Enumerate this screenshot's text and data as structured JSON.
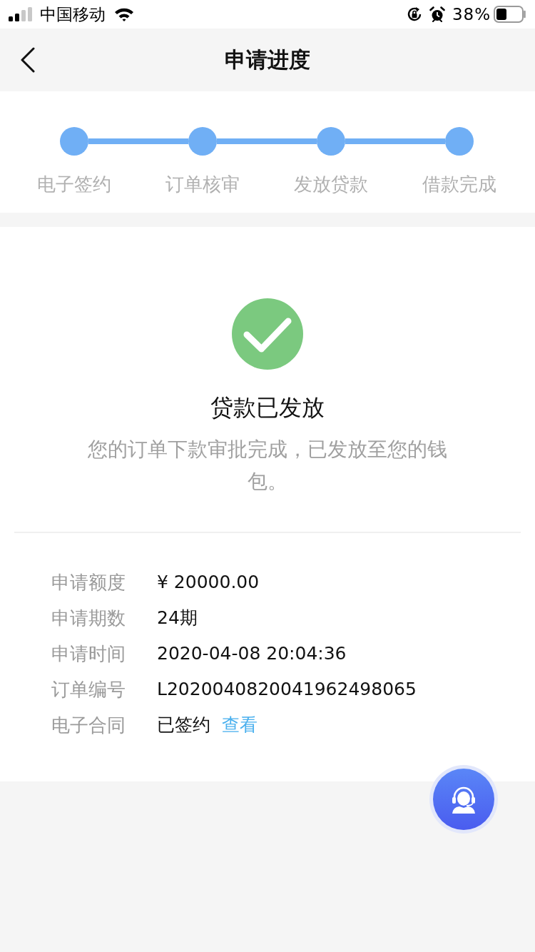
{
  "status_bar": {
    "carrier": "中国移动",
    "battery": "38%"
  },
  "nav": {
    "title": "申请进度"
  },
  "steps": [
    {
      "label": "电子签约",
      "done": true
    },
    {
      "label": "订单核审",
      "done": true
    },
    {
      "label": "发放贷款",
      "done": true
    },
    {
      "label": "借款完成",
      "done": true
    }
  ],
  "result": {
    "title": "贷款已发放",
    "message": "您的订单下款审批完成，已发放至您的钱包。"
  },
  "details": [
    {
      "label": "申请额度",
      "value": "¥ 20000.00"
    },
    {
      "label": "申请期数",
      "value": "24期"
    },
    {
      "label": "申请时间",
      "value": "2020-04-08 20:04:36"
    },
    {
      "label": "订单编号",
      "value": "L2020040820041962498065"
    },
    {
      "label": "电子合同",
      "value": "已签约",
      "link": "查看"
    }
  ]
}
